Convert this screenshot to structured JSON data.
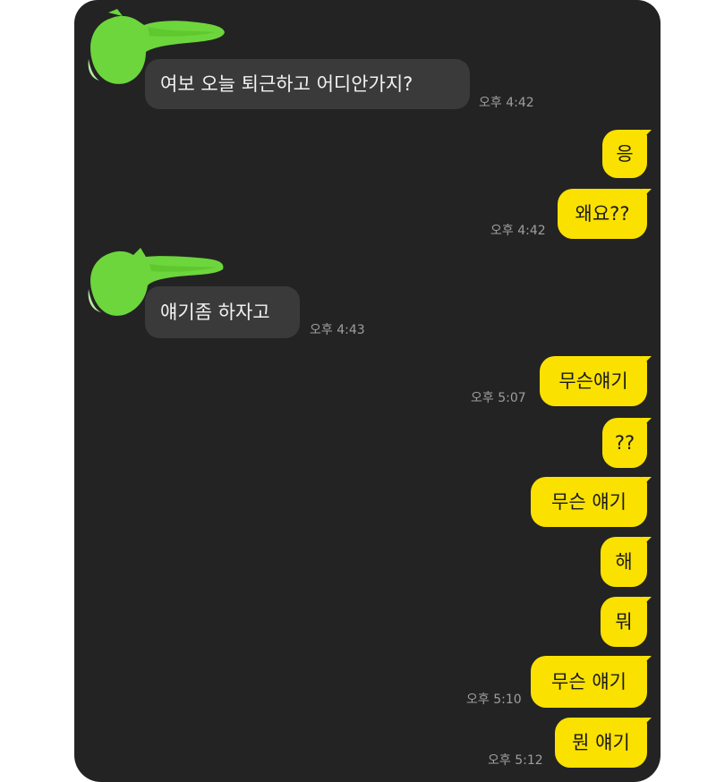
{
  "chat": {
    "messages": [
      {
        "side": "in",
        "text": "여보 오늘 퇴근하고 어디안가지?",
        "time": "오후 4:42"
      },
      {
        "side": "out",
        "text": "응",
        "time": ""
      },
      {
        "side": "out",
        "text": "왜요??",
        "time": "오후 4:42"
      },
      {
        "side": "in",
        "text": "얘기좀 하자고",
        "time": "오후 4:43"
      },
      {
        "side": "out",
        "text": "무슨얘기",
        "time": "오후 5:07"
      },
      {
        "side": "out",
        "text": "??",
        "time": ""
      },
      {
        "side": "out",
        "text": "무슨 얘기",
        "time": ""
      },
      {
        "side": "out",
        "text": "해",
        "time": ""
      },
      {
        "side": "out",
        "text": "뭐",
        "time": ""
      },
      {
        "side": "out",
        "text": "무슨 얘기",
        "time": "오후 5:10"
      },
      {
        "side": "out",
        "text": "뭔 얘기",
        "time": "오후 5:12"
      }
    ]
  },
  "colors": {
    "screen_background": "#232323",
    "incoming_bubble": "#3a3a3a",
    "outgoing_bubble": "#fae100",
    "avatar_scribble": "#6dd63c",
    "timestamp": "#9e9e9e"
  }
}
